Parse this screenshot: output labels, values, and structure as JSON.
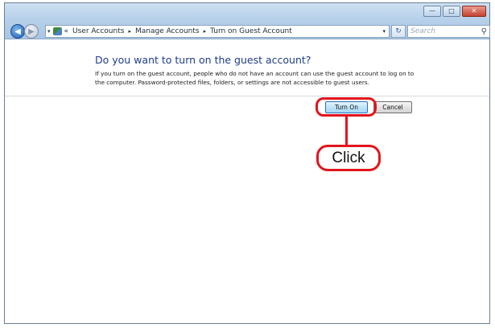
{
  "window": {
    "caption_buttons": {
      "minimize": "—",
      "maximize": "□",
      "close": "✕"
    }
  },
  "nav": {
    "back_glyph": "◀",
    "forward_glyph": "▶",
    "dropdown_glyph": "▾"
  },
  "address_bar": {
    "prefix": "«",
    "breadcrumbs": [
      "User Accounts",
      "Manage Accounts",
      "Turn on Guest Account"
    ],
    "separator": "▸",
    "dropdown_glyph": "▾",
    "refresh_glyph": "↻"
  },
  "search": {
    "placeholder": "Search",
    "icon": "🔍"
  },
  "content": {
    "heading": "Do you want to turn on the guest account?",
    "description": "If you turn on the guest account, people who do not have an account can use the guest account to log on to the computer. Password-protected files, folders, or settings are not accessible to guest users."
  },
  "buttons": {
    "turn_on": "Turn On",
    "cancel": "Cancel"
  },
  "annotation": {
    "callout_text": "Click",
    "color": "#e3141c"
  }
}
